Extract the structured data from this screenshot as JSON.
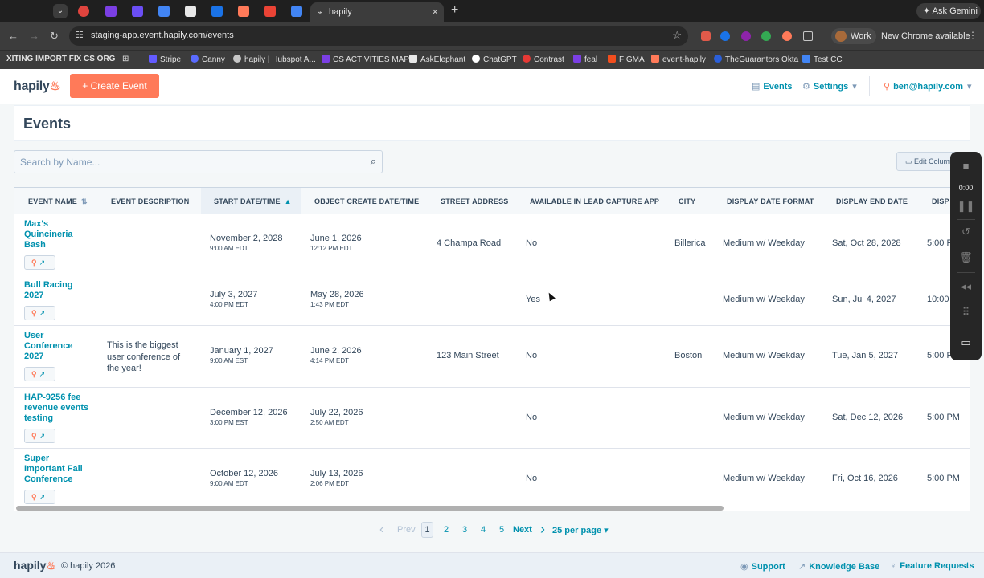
{
  "browser": {
    "active_tab_title": "hapily",
    "url": "staging-app.event.hapily.com/events",
    "ask_gemini": "Ask Gemini",
    "profile": "Work",
    "update_notice": "New Chrome available",
    "bookmarks": [
      "XITING IMPORT FIX",
      "CS ORG",
      "Stripe",
      "Canny",
      "hapily | Hubspot A...",
      "CS ACTIVITIES MAP",
      "AskElephant",
      "ChatGPT",
      "Contrast",
      "feal",
      "FIGMA",
      "event-hapily",
      "TheGuarantors Okta",
      "Test CC"
    ]
  },
  "header": {
    "logo": "hapily",
    "create_button": "+ Create Event",
    "nav_events": "Events",
    "nav_settings": "Settings",
    "user_email": "ben@hapily.com"
  },
  "page": {
    "title": "Events",
    "search_placeholder": "Search by Name...",
    "edit_columns": "Edit Columns"
  },
  "table": {
    "columns": [
      "EVENT NAME",
      "EVENT DESCRIPTION",
      "START DATE/TIME",
      "OBJECT CREATE DATE/TIME",
      "STREET ADDRESS",
      "AVAILABLE IN LEAD CAPTURE APP",
      "CITY",
      "DISPLAY DATE FORMAT",
      "DISPLAY END DATE",
      "DISP"
    ],
    "rows": [
      {
        "name": "Max's Quincineria Bash",
        "description": "",
        "start_date": "November 2, 2028",
        "start_time": "9:00 AM EDT",
        "create_date": "June 1, 2026",
        "create_time": "12:12 PM EDT",
        "street": "4 Champa Road",
        "lead_capture": "No",
        "city": "Billerica",
        "date_format": "Medium w/ Weekday",
        "end_date": "Sat, Oct 28, 2028",
        "end_time": "5:00 P"
      },
      {
        "name": "Bull Racing 2027",
        "description": "",
        "start_date": "July 3, 2027",
        "start_time": "4:00 PM EDT",
        "create_date": "May 28, 2026",
        "create_time": "1:43 PM EDT",
        "street": "",
        "lead_capture": "Yes",
        "city": "",
        "date_format": "Medium w/ Weekday",
        "end_date": "Sun, Jul 4, 2027",
        "end_time": "10:00"
      },
      {
        "name": "User Conference 2027",
        "description": "This is the biggest user conference of the year!",
        "start_date": "January 1, 2027",
        "start_time": "9:00 AM EST",
        "create_date": "June 2, 2026",
        "create_time": "4:14 PM EDT",
        "street": "123 Main Street",
        "lead_capture": "No",
        "city": "Boston",
        "date_format": "Medium w/ Weekday",
        "end_date": "Tue, Jan 5, 2027",
        "end_time": "5:00 P"
      },
      {
        "name": "HAP-9256 fee revenue events testing",
        "description": "",
        "start_date": "December 12, 2026",
        "start_time": "3:00 PM EST",
        "create_date": "July 22, 2026",
        "create_time": "2:50 AM EDT",
        "street": "",
        "lead_capture": "No",
        "city": "",
        "date_format": "Medium w/ Weekday",
        "end_date": "Sat, Dec 12, 2026",
        "end_time": "5:00 PM"
      },
      {
        "name": "Super Important Fall Conference",
        "description": "",
        "start_date": "October 12, 2026",
        "start_time": "9:00 AM EDT",
        "create_date": "July 13, 2026",
        "create_time": "2:06 PM EDT",
        "street": "",
        "lead_capture": "No",
        "city": "",
        "date_format": "Medium w/ Weekday",
        "end_date": "Fri, Oct 16, 2026",
        "end_time": "5:00 PM"
      }
    ]
  },
  "recorder": {
    "time": "0:00"
  },
  "pagination": {
    "prev": "Prev",
    "pages": [
      "1",
      "2",
      "3",
      "4",
      "5"
    ],
    "current": "1",
    "next": "Next",
    "per_page": "25 per page"
  },
  "footer": {
    "logo": "hapily",
    "copyright": "© hapily 2026",
    "support": "Support",
    "knowledge_base": "Knowledge Base",
    "feature_requests": "Feature Requests"
  },
  "colors": {
    "accent": "#ff7a59",
    "link": "#0091ae",
    "text": "#33475b"
  }
}
